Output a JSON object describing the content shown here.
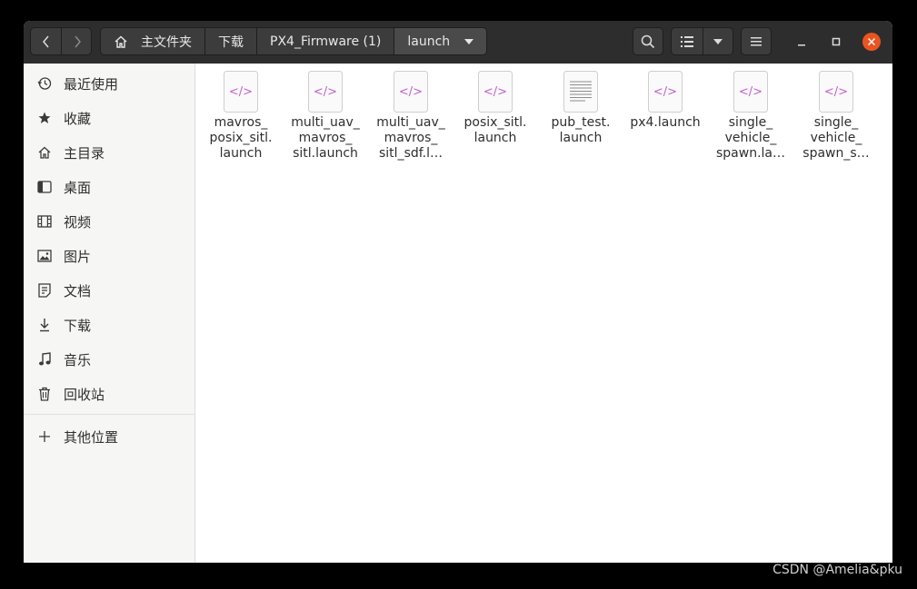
{
  "breadcrumb": {
    "items": [
      "主文件夹",
      "下载",
      "PX4_Firmware (1)",
      "launch"
    ]
  },
  "sidebar": {
    "items": [
      {
        "label": "最近使用",
        "icon": "recent-icon"
      },
      {
        "label": "收藏",
        "icon": "star-icon"
      },
      {
        "label": "主目录",
        "icon": "home-icon"
      },
      {
        "label": "桌面",
        "icon": "desktop-icon"
      },
      {
        "label": "视频",
        "icon": "video-icon"
      },
      {
        "label": "图片",
        "icon": "picture-icon"
      },
      {
        "label": "文档",
        "icon": "document-icon"
      },
      {
        "label": "下载",
        "icon": "download-icon"
      },
      {
        "label": "音乐",
        "icon": "music-icon"
      },
      {
        "label": "回收站",
        "icon": "trash-icon"
      }
    ],
    "other_locations": {
      "label": "其他位置",
      "icon": "plus-icon"
    }
  },
  "files": [
    {
      "name": "mavros_\nposix_sitl.\nlaunch",
      "type": "xml"
    },
    {
      "name": "multi_uav_\nmavros_\nsitl.launch",
      "type": "xml"
    },
    {
      "name": "multi_uav_\nmavros_\nsitl_sdf.l…",
      "type": "xml"
    },
    {
      "name": "posix_sitl.\nlaunch",
      "type": "xml"
    },
    {
      "name": "pub_test.\nlaunch",
      "type": "text"
    },
    {
      "name": "px4.launch",
      "type": "xml"
    },
    {
      "name": "single_\nvehicle_\nspawn.la…",
      "type": "xml"
    },
    {
      "name": "single_\nvehicle_\nspawn_s…",
      "type": "xml"
    }
  ],
  "watermark": "CSDN @Amelia&pku",
  "colors": {
    "headerbar": "#2d2d2d",
    "close_button": "#e95420",
    "xml_glyph": "#c061cb"
  }
}
